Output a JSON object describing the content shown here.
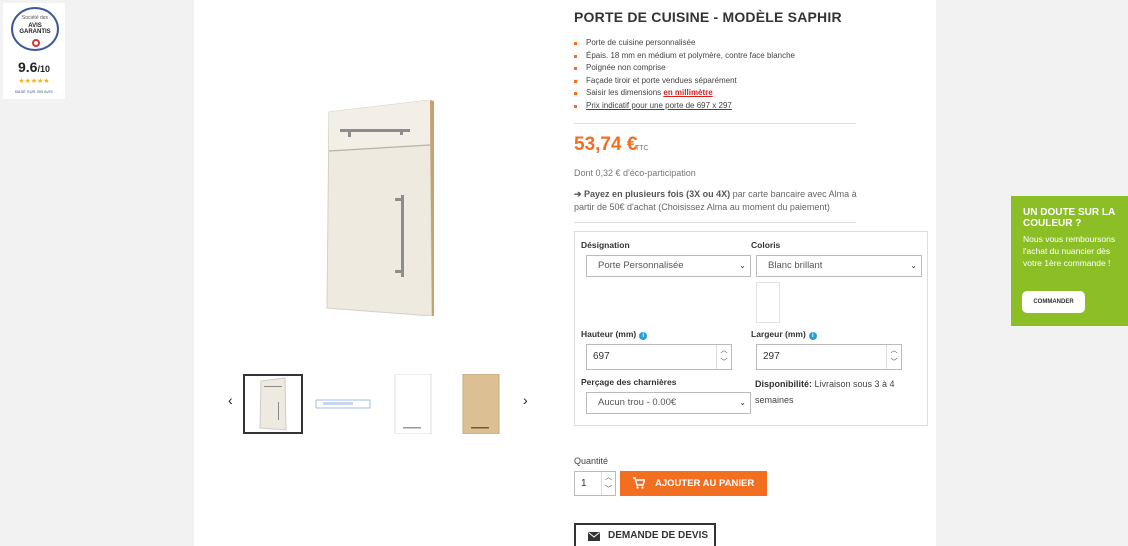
{
  "badge": {
    "line1": "Société des",
    "line2a": "AVIS",
    "line2b": "GARANTIS",
    "score": "9.6",
    "score_suffix": "/10",
    "stars": "★★★★★",
    "source": "BASÉ SUR 393 AVIS"
  },
  "product": {
    "title": "PORTE DE CUISINE - MODÈLE SAPHIR",
    "bullets": [
      "Porte de cuisine personnalisée",
      "Épais. 18 mm en médium et polymère, contre face blanche",
      "Poignée non comprise",
      "Façade tiroir et porte vendues séparément",
      "Saisir les dimensions ",
      "Prix indicatif pour une porte de 697 x 297"
    ],
    "bullet_link": "en millimètre",
    "price": "53,74 €",
    "ttc": "TTC",
    "eco": "Dont 0,32 € d'éco-participation",
    "alma_bold": "➔ Payez en plusieurs fois (3X ou 4X)",
    "alma_rest": " par carte bancaire avec Alma à partir de 50€ d'achat (Choisissez Alma au moment du paiement)"
  },
  "gallery": {
    "prev": "‹",
    "next": "›"
  },
  "config": {
    "designation_label": "Désignation",
    "designation_value": "Porte Personnalisée",
    "coloris_label": "Coloris",
    "coloris_value": "Blanc brillant",
    "hauteur_label": "Hauteur (mm)",
    "hauteur_value": "697",
    "largeur_label": "Largeur (mm)",
    "largeur_value": "297",
    "percage_label": "Perçage des charnières",
    "percage_value": "Aucun trou - 0.00€",
    "dispo_label": "Disponibilité:",
    "dispo_value": " Livraison sous 3 à 4 semaines",
    "info_icon": "i"
  },
  "cart": {
    "qty_label": "Quantité",
    "qty_value": "1",
    "add_label": "AJOUTER AU PANIER",
    "devis_label": "DEMANDE DE DEVIS"
  },
  "promo": {
    "heading": "UN DOUTE SUR LA COULEUR ?",
    "text": "Nous vous remboursons l'achat du nuancier dès votre 1ère commande !",
    "button": "COMMANDER"
  },
  "colors": {
    "accent": "#f26e21",
    "promo": "#8cbf26",
    "info": "#2a9fd6"
  }
}
